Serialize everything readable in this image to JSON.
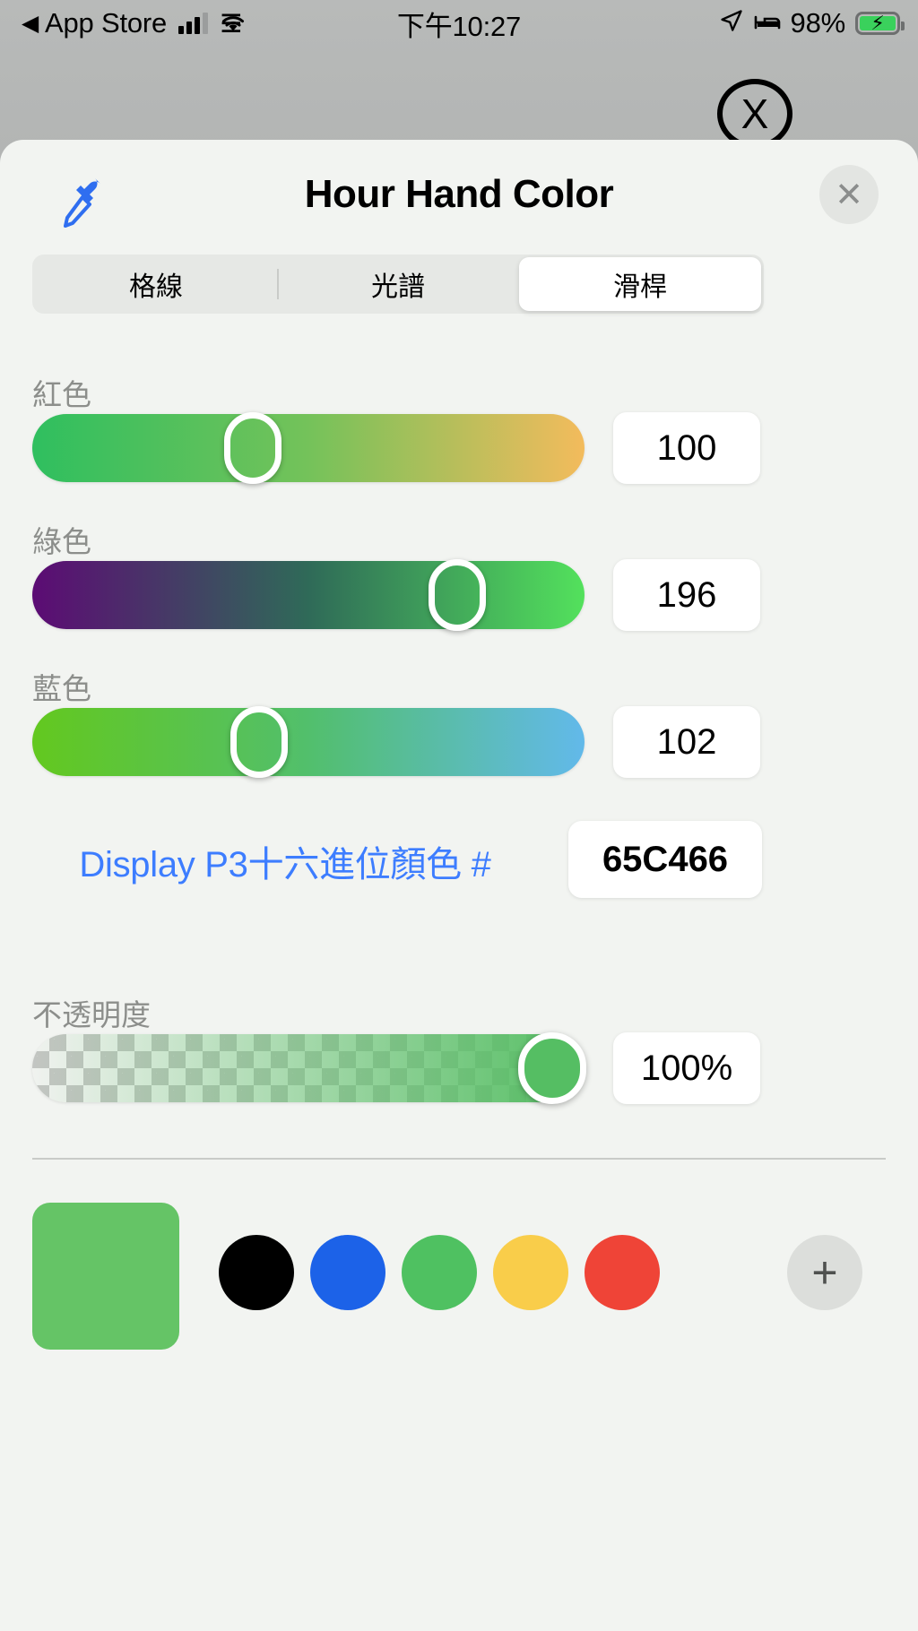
{
  "status_bar": {
    "back_app": "App Store",
    "back_arrow": "◀",
    "signal_icon": "cellular-signal-icon",
    "wifi_icon": "wifi-icon",
    "time": "下午10:27",
    "location_icon": "location-arrow-icon",
    "bed_icon": "bed-icon",
    "battery_percent": "98%",
    "battery_icon": "battery-charging-icon"
  },
  "overlay": {
    "close_label": "X"
  },
  "sheet": {
    "title": "Hour Hand Color",
    "eyedropper_icon": "eyedropper-icon",
    "close_label": "✕",
    "tabs": [
      {
        "label": "格線",
        "active": false
      },
      {
        "label": "光譜",
        "active": false
      },
      {
        "label": "滑桿",
        "active": true
      }
    ],
    "sliders": [
      {
        "name": "red",
        "label": "紅色",
        "value": "100",
        "percent": 40,
        "gradient_from": "#2fbf5f",
        "gradient_mid": "#74c25a",
        "gradient_to": "#f3bb5c"
      },
      {
        "name": "green",
        "label": "綠色",
        "value": "196",
        "percent": 77,
        "gradient_from": "#5c0b74",
        "gradient_mid": "#2f6a58",
        "gradient_to": "#53e15c"
      },
      {
        "name": "blue",
        "label": "藍色",
        "value": "102",
        "percent": 41,
        "gradient_from": "#63c81f",
        "gradient_mid": "#52bf6c",
        "gradient_to": "#62b9ea"
      }
    ],
    "hex": {
      "label": "Display P3十六進位顏色 #",
      "value": "65C466",
      "label_color": "#3d7dff"
    },
    "opacity": {
      "label": "不透明度",
      "value": "100%",
      "percent": 100,
      "fill_color": "#55be63"
    },
    "swatches": {
      "current_color": "#65c466",
      "items": [
        {
          "name": "swatch-black",
          "color": "#000000"
        },
        {
          "name": "swatch-blue",
          "color": "#1c62e8"
        },
        {
          "name": "swatch-green",
          "color": "#4fc161"
        },
        {
          "name": "swatch-yellow",
          "color": "#f9cd4a"
        },
        {
          "name": "swatch-red",
          "color": "#ef4437"
        }
      ],
      "add_label": "+"
    }
  }
}
